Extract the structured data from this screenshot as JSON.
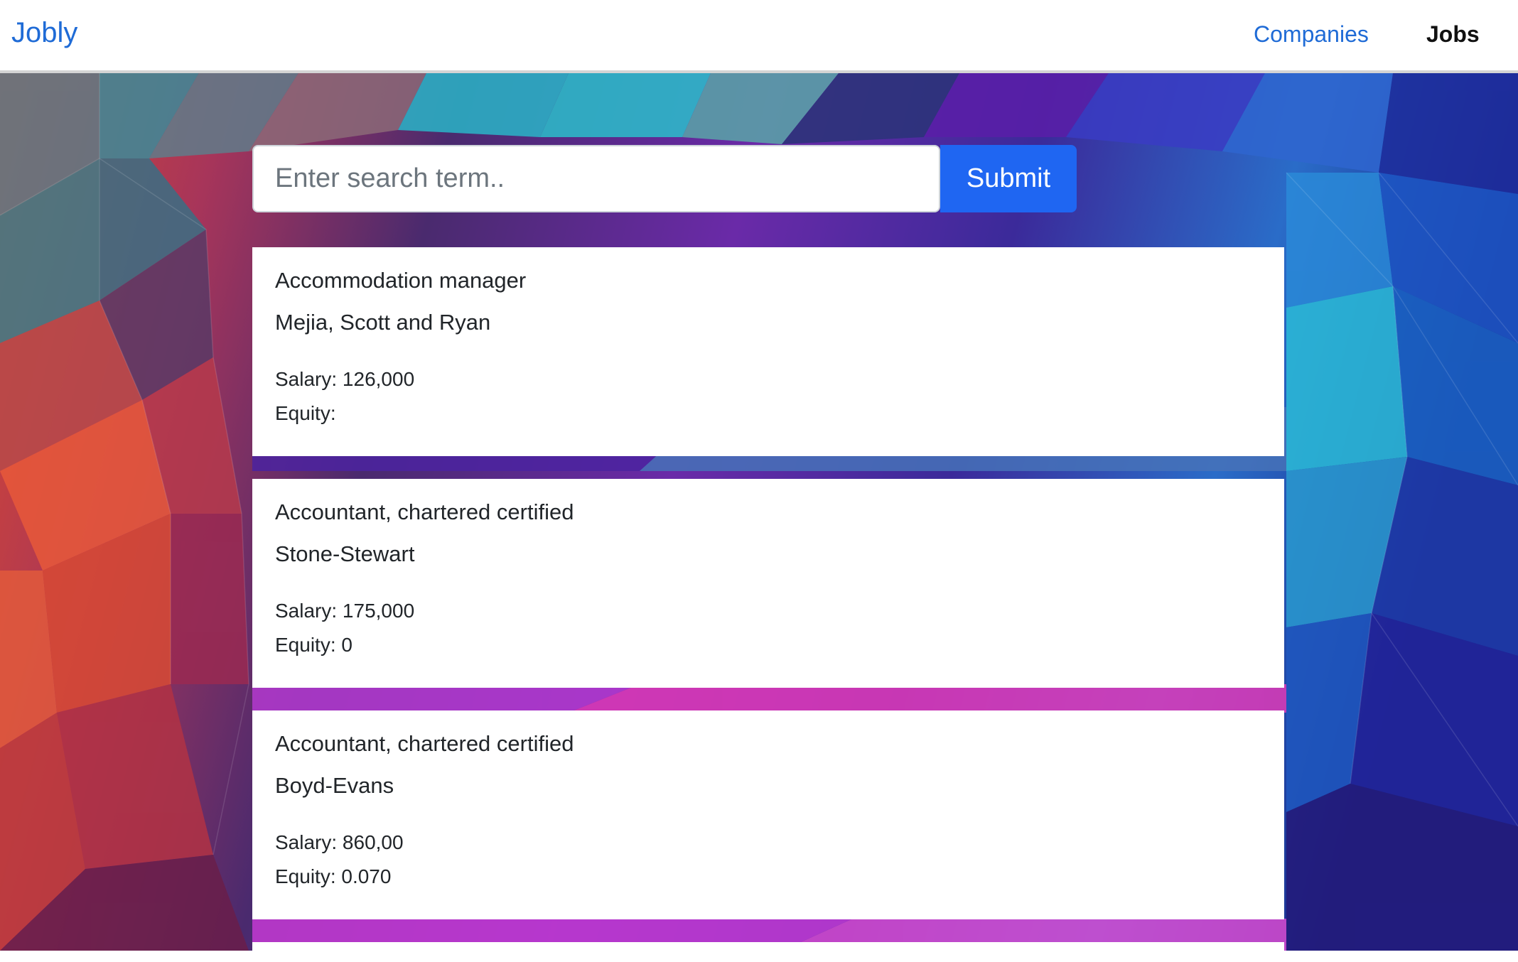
{
  "navbar": {
    "brand": "Jobly",
    "links": [
      {
        "label": "Companies",
        "active": false
      },
      {
        "label": "Jobs",
        "active": true
      }
    ]
  },
  "search": {
    "placeholder": "Enter search term..",
    "value": "",
    "submit_label": "Submit"
  },
  "jobs": [
    {
      "title": "Accommodation manager",
      "company": "Mejia, Scott and Ryan",
      "salary_label": "Salary: 126,000",
      "equity_label": "Equity:"
    },
    {
      "title": "Accountant, chartered certified",
      "company": "Stone-Stewart",
      "salary_label": "Salary: 175,000",
      "equity_label": "Equity: 0"
    },
    {
      "title": "Accountant, chartered certified",
      "company": "Boyd-Evans",
      "salary_label": "Salary: 860,00",
      "equity_label": "Equity: 0.070"
    }
  ],
  "colors": {
    "brand": "#1f6bd6",
    "submit_button": "#1f66f2"
  }
}
